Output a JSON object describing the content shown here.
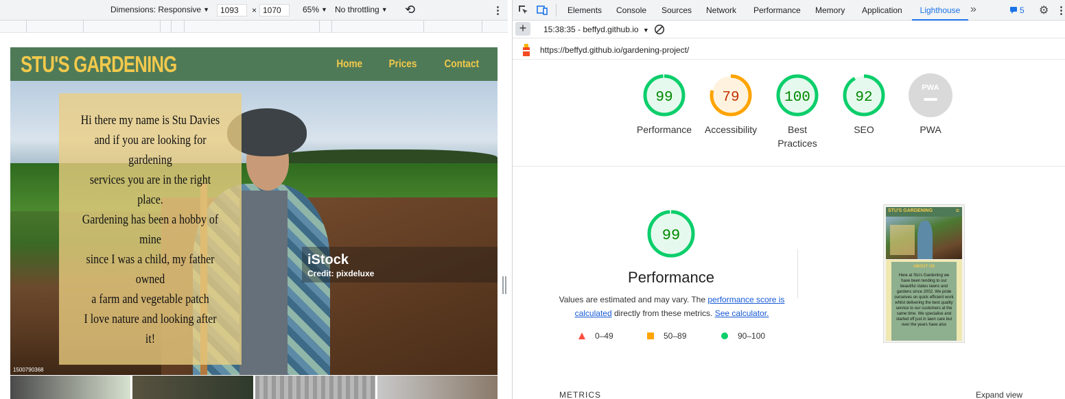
{
  "device_toolbar": {
    "dimensions_label": "Dimensions: Responsive",
    "width": "1093",
    "times": "×",
    "height": "1070",
    "zoom": "65%",
    "throttling": "No throttling"
  },
  "site": {
    "logo": "STU'S GARDENING",
    "nav": [
      "Home",
      "Prices",
      "Contact"
    ],
    "intro_lines": [
      "Hi there my name is Stu Davies",
      "and if you are looking for",
      "gardening",
      "services you are in the right",
      "place.",
      "Gardening has been a hobby of",
      "mine",
      "since I was a child, my father",
      "owned",
      "a farm and vegetable patch",
      "I love nature and looking after",
      "it!"
    ],
    "watermark_logo": "iStock",
    "watermark_credit": "Credit: pixdeluxe",
    "stock_id": "1500790368"
  },
  "devtools": {
    "tabs": [
      "Elements",
      "Console",
      "Sources",
      "Network",
      "Performance",
      "Memory",
      "Application",
      "Lighthouse"
    ],
    "active_tab": "Lighthouse",
    "more": "»",
    "issues_count": "5",
    "report_selector": "15:38:35 - beffyd.github.io",
    "url": "https://beffyd.github.io/gardening-project/"
  },
  "lighthouse": {
    "scores": [
      {
        "name": "Performance",
        "value": 99,
        "color": "#0cce6b",
        "bg": "#e6f9ee",
        "text": "#008800"
      },
      {
        "name": "Accessibility",
        "value": 79,
        "color": "#ffa400",
        "bg": "#fff3e0",
        "text": "#c33300"
      },
      {
        "name": "Best Practices",
        "value": 100,
        "color": "#0cce6b",
        "bg": "#e6f9ee",
        "text": "#008800"
      },
      {
        "name": "SEO",
        "value": 92,
        "color": "#0cce6b",
        "bg": "#e6f9ee",
        "text": "#008800"
      },
      {
        "name": "PWA",
        "value": null,
        "color": "#c5c5c5",
        "bg": "#e3e3e3",
        "text": "#ffffff"
      }
    ],
    "pwa_badge": "PWA",
    "perf_big_score": "99",
    "perf_title": "Performance",
    "desc_prefix": "Values are estimated and may vary. The ",
    "desc_link1": "performance score is calculated",
    "desc_middle": " directly from these metrics. ",
    "desc_link2": "See calculator.",
    "legend": [
      {
        "range": "0–49",
        "shape": "triangle",
        "color": "#ff4e42"
      },
      {
        "range": "50–89",
        "shape": "square",
        "color": "#ffa400"
      },
      {
        "range": "90–100",
        "shape": "circle",
        "color": "#0cce6b"
      }
    ],
    "metrics_label": "METRICS",
    "expand_view": "Expand view",
    "mini_logo": "STU'S GARDENING",
    "mini_heading": "ABOUT US",
    "mini_text": "Here at Stu's Gardening we have been tending to our beautiful states lawns and gardens since 2002. We pride ourselves on quick efficient work whilst delivering the best quality service to our customers at the same time. We specialise and started off just in lawn care but over the years have also"
  }
}
